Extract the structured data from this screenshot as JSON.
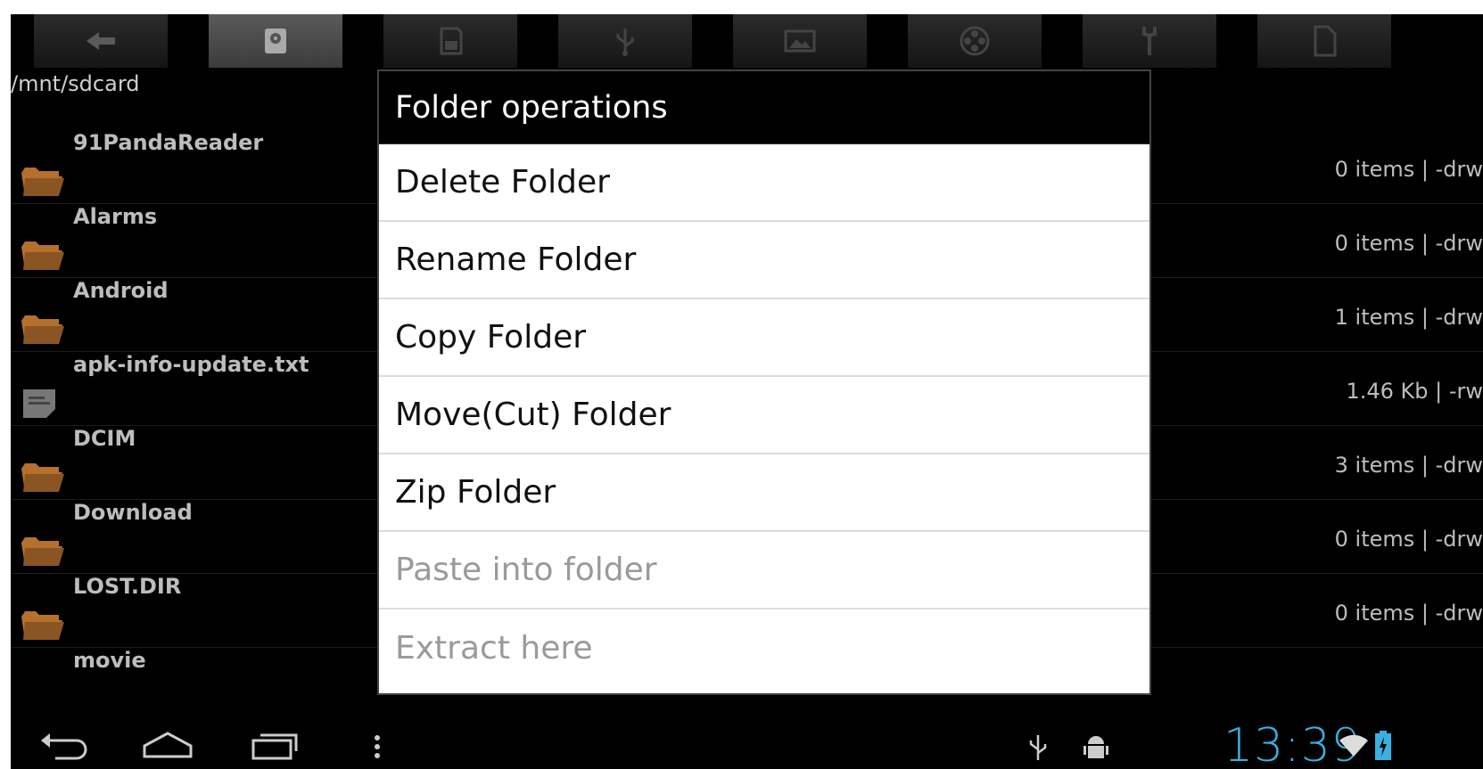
{
  "toolbar": {
    "icons": [
      "back-arrow-icon",
      "sdcard-icon",
      "sd-icon",
      "usb-icon",
      "image-icon",
      "video-icon",
      "tools-icon",
      "document-icon"
    ],
    "active_index": 1
  },
  "path": "/mnt/sdcard",
  "files": [
    {
      "name": "91PandaReader",
      "meta": "0 items | -drw",
      "type": "folder"
    },
    {
      "name": "Alarms",
      "meta": "0 items | -drw",
      "type": "folder"
    },
    {
      "name": "Android",
      "meta": "1 items | -drw",
      "type": "folder"
    },
    {
      "name": "apk-info-update.txt",
      "meta": "1.46 Kb  | -rw",
      "type": "file"
    },
    {
      "name": "DCIM",
      "meta": "3 items | -drw",
      "type": "folder"
    },
    {
      "name": "Download",
      "meta": "0 items | -drw",
      "type": "folder"
    },
    {
      "name": "LOST.DIR",
      "meta": "0 items | -drw",
      "type": "folder"
    },
    {
      "name": "movie",
      "meta": "",
      "type": "folder"
    }
  ],
  "dialog": {
    "title": "Folder operations",
    "options": [
      {
        "label": "Delete Folder",
        "enabled": true
      },
      {
        "label": "Rename Folder",
        "enabled": true
      },
      {
        "label": "Copy Folder",
        "enabled": true
      },
      {
        "label": "Move(Cut) Folder",
        "enabled": true
      },
      {
        "label": "Zip Folder",
        "enabled": true
      },
      {
        "label": "Paste into folder",
        "enabled": false
      },
      {
        "label": "Extract here",
        "enabled": false
      }
    ]
  },
  "statusbar": {
    "time": "13:39",
    "icons": [
      "usb-icon",
      "android-debug-icon",
      "wifi-icon",
      "battery-icon"
    ]
  },
  "navbar": {
    "icons": [
      "back-icon",
      "home-icon",
      "recent-apps-icon",
      "menu-icon"
    ]
  },
  "colors": {
    "clock": "#38b0e0",
    "folder": "#b5702e"
  }
}
